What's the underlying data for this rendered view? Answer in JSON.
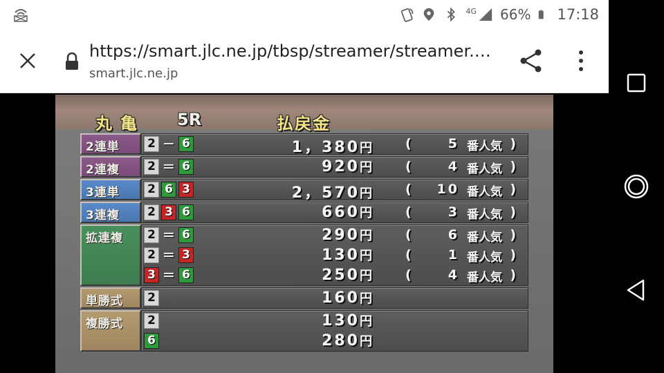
{
  "status_bar": {
    "battery": "66%",
    "time": "17:18",
    "network": "4G",
    "icons": [
      "wifi-calling-icon",
      "nfc-icon",
      "location-icon",
      "bluetooth-icon",
      "signal-icon",
      "battery-icon"
    ]
  },
  "browser": {
    "url": "https://smart.jlc.ne.jp/tbsp/streamer/streamer.…",
    "domain": "smart.jlc.ne.jp"
  },
  "board": {
    "venue": "丸亀",
    "race": "5R",
    "payout_title": "払戻金",
    "rows": [
      {
        "label": "2連単",
        "color": "purple",
        "lines": [
          {
            "combo": [
              {
                "n": "2",
                "c": "white"
              },
              {
                "sep": "－"
              },
              {
                "n": "6",
                "c": "green"
              }
            ],
            "amount": "1，380",
            "pop": "5"
          }
        ]
      },
      {
        "label": "2連複",
        "color": "purple",
        "lines": [
          {
            "combo": [
              {
                "n": "2",
                "c": "white"
              },
              {
                "sep": "＝"
              },
              {
                "n": "6",
                "c": "green"
              }
            ],
            "amount": "920",
            "pop": "4"
          }
        ]
      },
      {
        "label": "3連単",
        "color": "blue",
        "lines": [
          {
            "combo": [
              {
                "n": "2",
                "c": "white"
              },
              {
                "n": "6",
                "c": "green"
              },
              {
                "n": "3",
                "c": "red"
              }
            ],
            "amount": "2，570",
            "pop": "10"
          }
        ]
      },
      {
        "label": "3連複",
        "color": "blue",
        "lines": [
          {
            "combo": [
              {
                "n": "2",
                "c": "white"
              },
              {
                "n": "3",
                "c": "red"
              },
              {
                "n": "6",
                "c": "green"
              }
            ],
            "amount": "660",
            "pop": "3"
          }
        ]
      },
      {
        "label": "拡連複",
        "color": "green",
        "lines": [
          {
            "combo": [
              {
                "n": "2",
                "c": "white"
              },
              {
                "sep": "＝"
              },
              {
                "n": "6",
                "c": "green"
              }
            ],
            "amount": "290",
            "pop": "6"
          },
          {
            "combo": [
              {
                "n": "2",
                "c": "white"
              },
              {
                "sep": "＝"
              },
              {
                "n": "3",
                "c": "red"
              }
            ],
            "amount": "130",
            "pop": "1"
          },
          {
            "combo": [
              {
                "n": "3",
                "c": "red"
              },
              {
                "sep": "＝"
              },
              {
                "n": "6",
                "c": "green"
              }
            ],
            "amount": "250",
            "pop": "4"
          }
        ]
      },
      {
        "label": "単勝式",
        "color": "tan",
        "lines": [
          {
            "combo": [
              {
                "n": "2",
                "c": "white"
              }
            ],
            "amount": "160",
            "pop": ""
          }
        ]
      },
      {
        "label": "複勝式",
        "color": "tan",
        "lines": [
          {
            "combo": [
              {
                "n": "2",
                "c": "white"
              }
            ],
            "amount": "130",
            "pop": ""
          },
          {
            "combo": [
              {
                "n": "6",
                "c": "green"
              }
            ],
            "amount": "280",
            "pop": ""
          }
        ]
      }
    ],
    "yen_unit": "円",
    "pop_open": "(",
    "pop_close": ")",
    "pop_suffix": "番人気"
  }
}
